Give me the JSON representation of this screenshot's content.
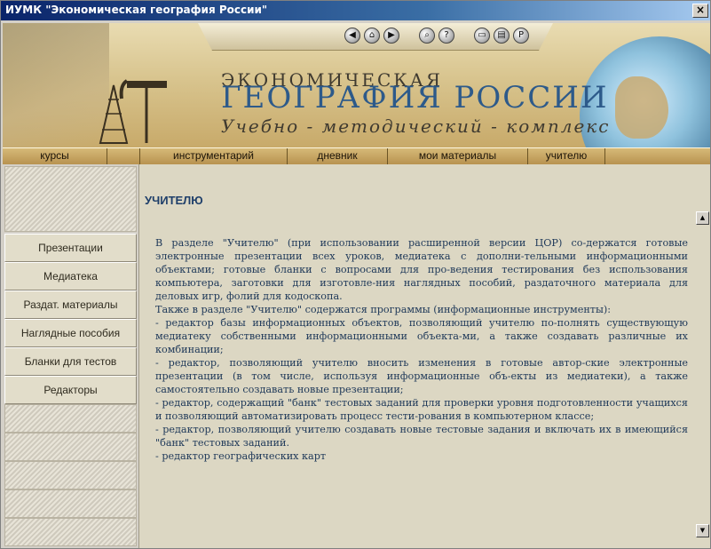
{
  "window": {
    "title": "ИУМК \"Экономическая география России\"",
    "close_glyph": "×"
  },
  "header": {
    "brand_small": "ЭКОНОМИЧЕСКАЯ",
    "brand_big": "ГЕОГРАФИЯ РОССИИ",
    "brand_sub": "Учебно - методический - комплекс",
    "nav_icons": [
      {
        "name": "back-icon",
        "glyph": "◀"
      },
      {
        "name": "home-icon",
        "glyph": "⌂"
      },
      {
        "name": "forward-icon",
        "glyph": "▶"
      },
      {
        "name": "search-icon",
        "glyph": "⌕"
      },
      {
        "name": "help-icon",
        "glyph": "?"
      },
      {
        "name": "monitor-icon",
        "glyph": "▭"
      },
      {
        "name": "calendar-icon",
        "glyph": "▤"
      },
      {
        "name": "p-icon",
        "glyph": "P"
      }
    ]
  },
  "menu": {
    "items": [
      {
        "label": "курсы"
      },
      {
        "label": ""
      },
      {
        "label": "инструментарий"
      },
      {
        "label": "дневник"
      },
      {
        "label": "мои материалы"
      },
      {
        "label": "учителю"
      }
    ]
  },
  "sidebar": {
    "items": [
      {
        "label": "Презентации"
      },
      {
        "label": "Медиатека"
      },
      {
        "label": "Раздат. материалы"
      },
      {
        "label": "Наглядные пособия"
      },
      {
        "label": "Бланки для тестов"
      },
      {
        "label": "Редакторы"
      }
    ]
  },
  "content": {
    "title": "УЧИТЕЛЮ",
    "paragraphs": [
      "В разделе \"Учителю\" (при использовании расширенной версии ЦОР) со-держатся готовые электронные презентации всех уроков, медиатека с дополни-тельными информационными объектами; готовые бланки с вопросами для про-ведения тестирования без использования компьютера, заготовки для изготовле-ния наглядных пособий, раздаточного материала для деловых игр, фолий для кодоскопа.",
      "Также в разделе \"Учителю\" содержатся программы (информационные инструменты):",
      "- редактор базы информационных объектов, позволяющий учителю по-полнять существующую медиатеку собственными информационными объекта-ми, а также создавать различные их комбинации;",
      "- редактор, позволяющий учителю вносить изменения в готовые автор-ские электронные презентации (в том числе, используя информационные объ-екты из медиатеки), а также самостоятельно создавать новые презентации;",
      "- редактор, содержащий \"банк\" тестовых заданий для проверки уровня подготовленности учащихся и позволяющий автоматизировать процесс тести-рования в компьютерном классе;",
      "- редактор, позволяющий учителю создавать новые тестовые задания и включать их в имеющийся \"банк\" тестовых заданий.",
      "- редактор географических карт"
    ]
  },
  "scrollbar": {
    "up_glyph": "▲",
    "down_glyph": "▼"
  }
}
